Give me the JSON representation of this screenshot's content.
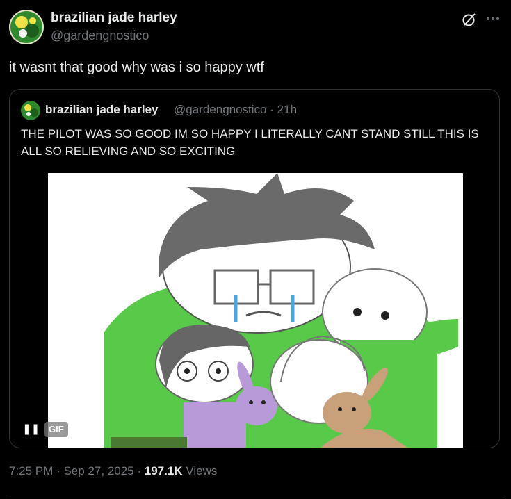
{
  "author": {
    "name": "brazilian jade harley",
    "handle": "@gardengnostico"
  },
  "tweet": {
    "text": "it wasnt that good why was i so happy wtf"
  },
  "quoted": {
    "name": "brazilian jade harley",
    "handle": "@gardengnostico",
    "separator": "·",
    "time": "21h",
    "text": "THE PILOT WAS SO GOOD IM SO HAPPY I LITERALLY CANT STAND STILL THIS IS ALL SO RELIEVING AND SO EXCITING",
    "media": {
      "pause_glyph": "❚❚",
      "badge": "GIF"
    }
  },
  "footer": {
    "time": "7:25 PM",
    "sep1": "·",
    "date": "Sep 27, 2025",
    "sep2": "·",
    "views_count": "197.1K",
    "views_label": "Views"
  },
  "icons": {
    "grok": "grok-icon",
    "more": "more-icon",
    "pause": "pause-icon"
  },
  "colors": {
    "background": "#000000",
    "text": "#e7e9ea",
    "muted": "#71767b",
    "border": "#2f3336",
    "avatar_green": "#3aa83a"
  }
}
